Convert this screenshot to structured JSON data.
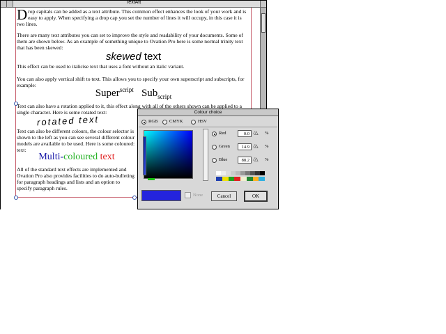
{
  "window": {
    "title": "TextAtt"
  },
  "doc": {
    "drop_cap": "D",
    "p1": "rop capitals can be added as a text attribute. This common effect enhances the look of your work and is easy to apply. When specifying a drop cap you set the number of lines it will occupy, in this case it is two lines.",
    "p2": "There are many text attributes you can set to improve the style and readability of your documents. Some of them are shown below. As an example of something unique to Ovation Pro here is some normal trinity text that has been skewed:",
    "skew_a": "skewed",
    "skew_b": " text",
    "p3": "This effect can be used to italicise text that uses a font without an italic variant.",
    "p4": "You can also apply vertical shift to text. This allows you to specify your own superscript and subscripts, for example:",
    "super_base": "Super",
    "super_script": "script",
    "sub_base": "Sub",
    "sub_script": "script",
    "p5": "Text can also have a rotation applied to it, this effect along with all of the others shown can be applied to a single character. Here is some rotated text:",
    "rotated": "rotated text",
    "p6": "Text can also be different colours, the colour selector is shown to the left as you can see several different colour models are available to be used. Here is some coloured: text:",
    "multi_1": "Multi-",
    "multi_2": "coloured",
    "multi_3": " text",
    "p7": "All of the standard text effects are implemented and Ovation Pro also provides facilities to do auto-bulleting for paragraph headings and lists and an option to specify paragraph rules."
  },
  "dialog": {
    "title": "Colour choice",
    "models": [
      "RGB",
      "CMYK",
      "HSV"
    ],
    "channels": [
      {
        "label": "Red",
        "value": "0.0",
        "unit": "%"
      },
      {
        "label": "Green",
        "value": "14.9",
        "unit": "%"
      },
      {
        "label": "Blue",
        "value": "88.2",
        "unit": "%"
      }
    ],
    "none_label": "None",
    "cancel_label": "Cancel",
    "ok_label": "OK"
  },
  "colors": {
    "multi_1": "#1a1aa8",
    "multi_2": "#22b022",
    "multi_3": "#e02020",
    "frame": "#c8606e",
    "sample": "#2424dd",
    "palette_row1": [
      "#ffffff",
      "#eeeeee",
      "#dddddd",
      "#cccccc",
      "#bbbbbb",
      "#999999",
      "#777777",
      "#555555",
      "#333333",
      "#000000"
    ],
    "palette_row2": [
      "#1f3fb0",
      "#f0e000",
      "#22a020",
      "#e02020",
      "#f0f0d0",
      "#228833",
      "#ffb020",
      "#30b0e0"
    ]
  }
}
